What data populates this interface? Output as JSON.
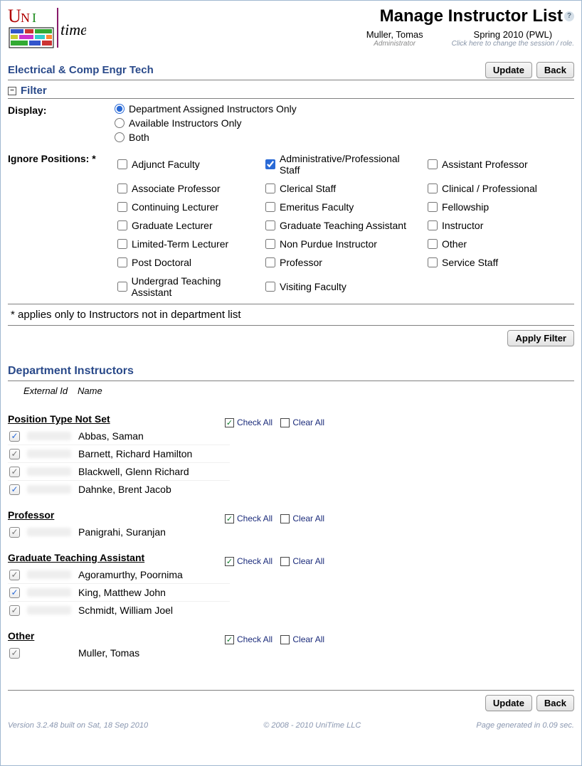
{
  "header": {
    "page_title": "Manage Instructor List",
    "user_name": "Muller, Tomas",
    "user_role": "Administrator",
    "session_name": "Spring 2010 (PWL)",
    "session_hint": "Click here to change the session / role."
  },
  "dept": {
    "title": "Electrical & Comp Engr Tech",
    "update_label": "Update",
    "back_label": "Back"
  },
  "filter": {
    "section_label": "Filter",
    "display_label": "Display:",
    "display_options": [
      {
        "label": "Department Assigned Instructors Only",
        "selected": true
      },
      {
        "label": "Available Instructors Only",
        "selected": false
      },
      {
        "label": "Both",
        "selected": false
      }
    ],
    "ignore_label": "Ignore Positions: *",
    "positions": [
      {
        "label": "Adjunct Faculty",
        "checked": false
      },
      {
        "label": "Administrative/Professional Staff",
        "checked": true
      },
      {
        "label": "Assistant Professor",
        "checked": false
      },
      {
        "label": "Associate Professor",
        "checked": false
      },
      {
        "label": "Clerical Staff",
        "checked": false
      },
      {
        "label": "Clinical / Professional",
        "checked": false
      },
      {
        "label": "Continuing Lecturer",
        "checked": false
      },
      {
        "label": "Emeritus Faculty",
        "checked": false
      },
      {
        "label": "Fellowship",
        "checked": false
      },
      {
        "label": "Graduate Lecturer",
        "checked": false
      },
      {
        "label": "Graduate Teaching Assistant",
        "checked": false
      },
      {
        "label": "Instructor",
        "checked": false
      },
      {
        "label": "Limited-Term Lecturer",
        "checked": false
      },
      {
        "label": "Non Purdue Instructor",
        "checked": false
      },
      {
        "label": "Other",
        "checked": false
      },
      {
        "label": "Post Doctoral",
        "checked": false
      },
      {
        "label": "Professor",
        "checked": false
      },
      {
        "label": "Service Staff",
        "checked": false
      },
      {
        "label": "Undergrad Teaching Assistant",
        "checked": false
      },
      {
        "label": "Visiting Faculty",
        "checked": false
      }
    ],
    "note": "* applies only to Instructors not in department list",
    "apply_label": "Apply Filter"
  },
  "list": {
    "section_title": "Department Instructors",
    "col_ext": "External Id",
    "col_name": "Name",
    "check_all": "Check All",
    "clear_all": "Clear All",
    "groups": [
      {
        "title": "Position Type Not Set",
        "rows": [
          {
            "name": "Abbas, Saman",
            "checked": "on"
          },
          {
            "name": "Barnett, Richard Hamilton",
            "checked": "dim"
          },
          {
            "name": "Blackwell, Glenn Richard",
            "checked": "dim"
          },
          {
            "name": "Dahnke, Brent Jacob",
            "checked": "on"
          }
        ]
      },
      {
        "title": "Professor",
        "rows": [
          {
            "name": "Panigrahi, Suranjan",
            "checked": "dim"
          }
        ]
      },
      {
        "title": "Graduate Teaching Assistant",
        "rows": [
          {
            "name": "Agoramurthy, Poornima",
            "checked": "dim"
          },
          {
            "name": "King, Matthew John",
            "checked": "on"
          },
          {
            "name": "Schmidt, William Joel",
            "checked": "dim"
          }
        ]
      },
      {
        "title": "Other",
        "rows": [
          {
            "name": "Muller, Tomas",
            "checked": "dim",
            "no_ext": true
          }
        ]
      }
    ]
  },
  "footer": {
    "version": "Version 3.2.48 built on Sat, 18 Sep 2010",
    "copyright": "© 2008 - 2010 UniTime LLC",
    "timing": "Page generated in 0.09 sec."
  }
}
